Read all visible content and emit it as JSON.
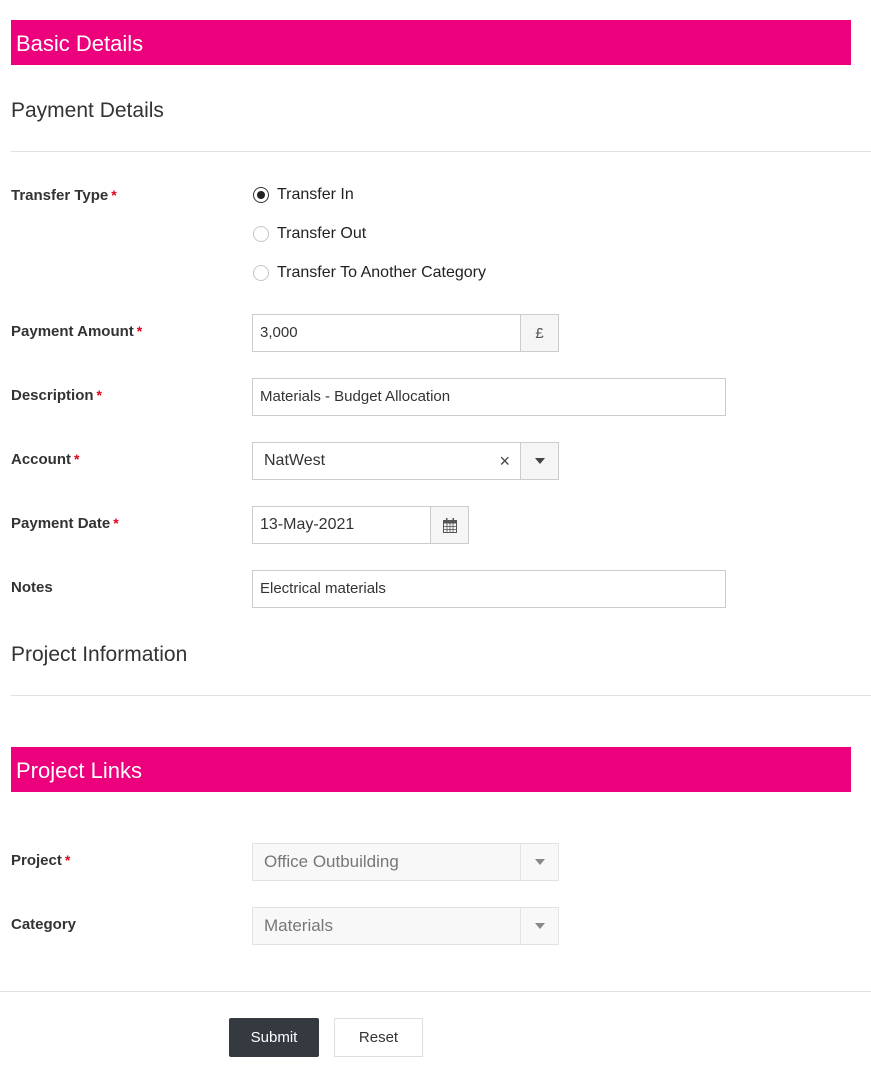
{
  "sections": {
    "basic_details": "Basic Details",
    "payment_details": "Payment Details",
    "project_information": "Project Information",
    "project_links": "Project Links"
  },
  "required_marker": "*",
  "colors": {
    "banner": "#ec007c",
    "required": "#e3001b",
    "primary_button": "#343a40"
  },
  "form": {
    "transfer_type": {
      "label": "Transfer Type",
      "required": true,
      "options": [
        {
          "label": "Transfer In",
          "checked": true
        },
        {
          "label": "Transfer Out",
          "checked": false
        },
        {
          "label": "Transfer To Another Category",
          "checked": false
        }
      ]
    },
    "payment_amount": {
      "label": "Payment Amount",
      "required": true,
      "value": "3,000",
      "currency_symbol": "£"
    },
    "description": {
      "label": "Description",
      "required": true,
      "value": "Materials - Budget Allocation"
    },
    "account": {
      "label": "Account",
      "required": true,
      "value": "NatWest",
      "clear_icon": "×"
    },
    "payment_date": {
      "label": "Payment Date",
      "required": true,
      "value": "13-May-2021",
      "icon": "calendar-icon"
    },
    "notes": {
      "label": "Notes",
      "required": false,
      "value": "Electrical materials"
    },
    "project": {
      "label": "Project",
      "required": true,
      "value": "Office Outbuilding",
      "disabled": true
    },
    "category": {
      "label": "Category",
      "required": false,
      "value": "Materials",
      "disabled": true
    }
  },
  "buttons": {
    "submit": "Submit",
    "reset": "Reset"
  }
}
